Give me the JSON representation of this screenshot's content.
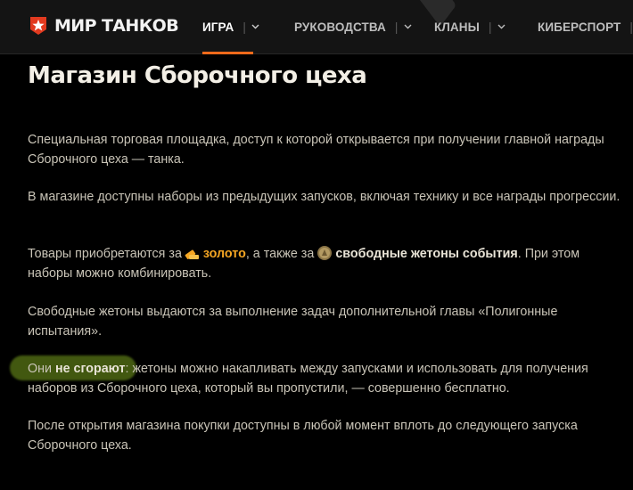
{
  "header": {
    "logo_text": "МИР ТАНКОВ",
    "nav": [
      {
        "label": "ИГРА",
        "active": true
      },
      {
        "label": "РУКОВОДСТВА",
        "active": false
      },
      {
        "label": "КЛАНЫ",
        "active": false
      },
      {
        "label": "КИБЕРСПОРТ",
        "active": false
      }
    ]
  },
  "article": {
    "title": "Магазин Сборочного цеха",
    "p1": "Специальная торговая площадка, доступ к которой открывается при получении главной награды Сборочного цеха — танка.",
    "p2": "В магазине доступны наборы из предыдущих запусков, включая технику и все награды прогрессии.",
    "p3": {
      "before": "Товары приобретаются за",
      "gold": "золото",
      "middle": ", а также за",
      "tokens": "свободные жетоны события",
      "after": ". При этом наборы можно комбинировать."
    },
    "p4": "Свободные жетоны выдаются за выполнение задач дополнительной главы «Полигонные испытания».",
    "p5": {
      "before": "Они ",
      "strong": "не сгорают",
      "after": ": жетоны можно накапливать между запусками и использовать для получения наборов из Сборочного цеха, который вы пропустили, — совершенно бесплатно."
    },
    "p6": "После открытия магазина покупки доступны в любой момент вплоть до следующего запуска Сборочного цеха."
  },
  "colors": {
    "accent": "#f26a1b",
    "gold": "#f5a623",
    "highlight": "#78a01e"
  },
  "icons": [
    "wot-star-logo-icon",
    "chevron-down-icon",
    "gold-icon",
    "token-coin-icon"
  ]
}
